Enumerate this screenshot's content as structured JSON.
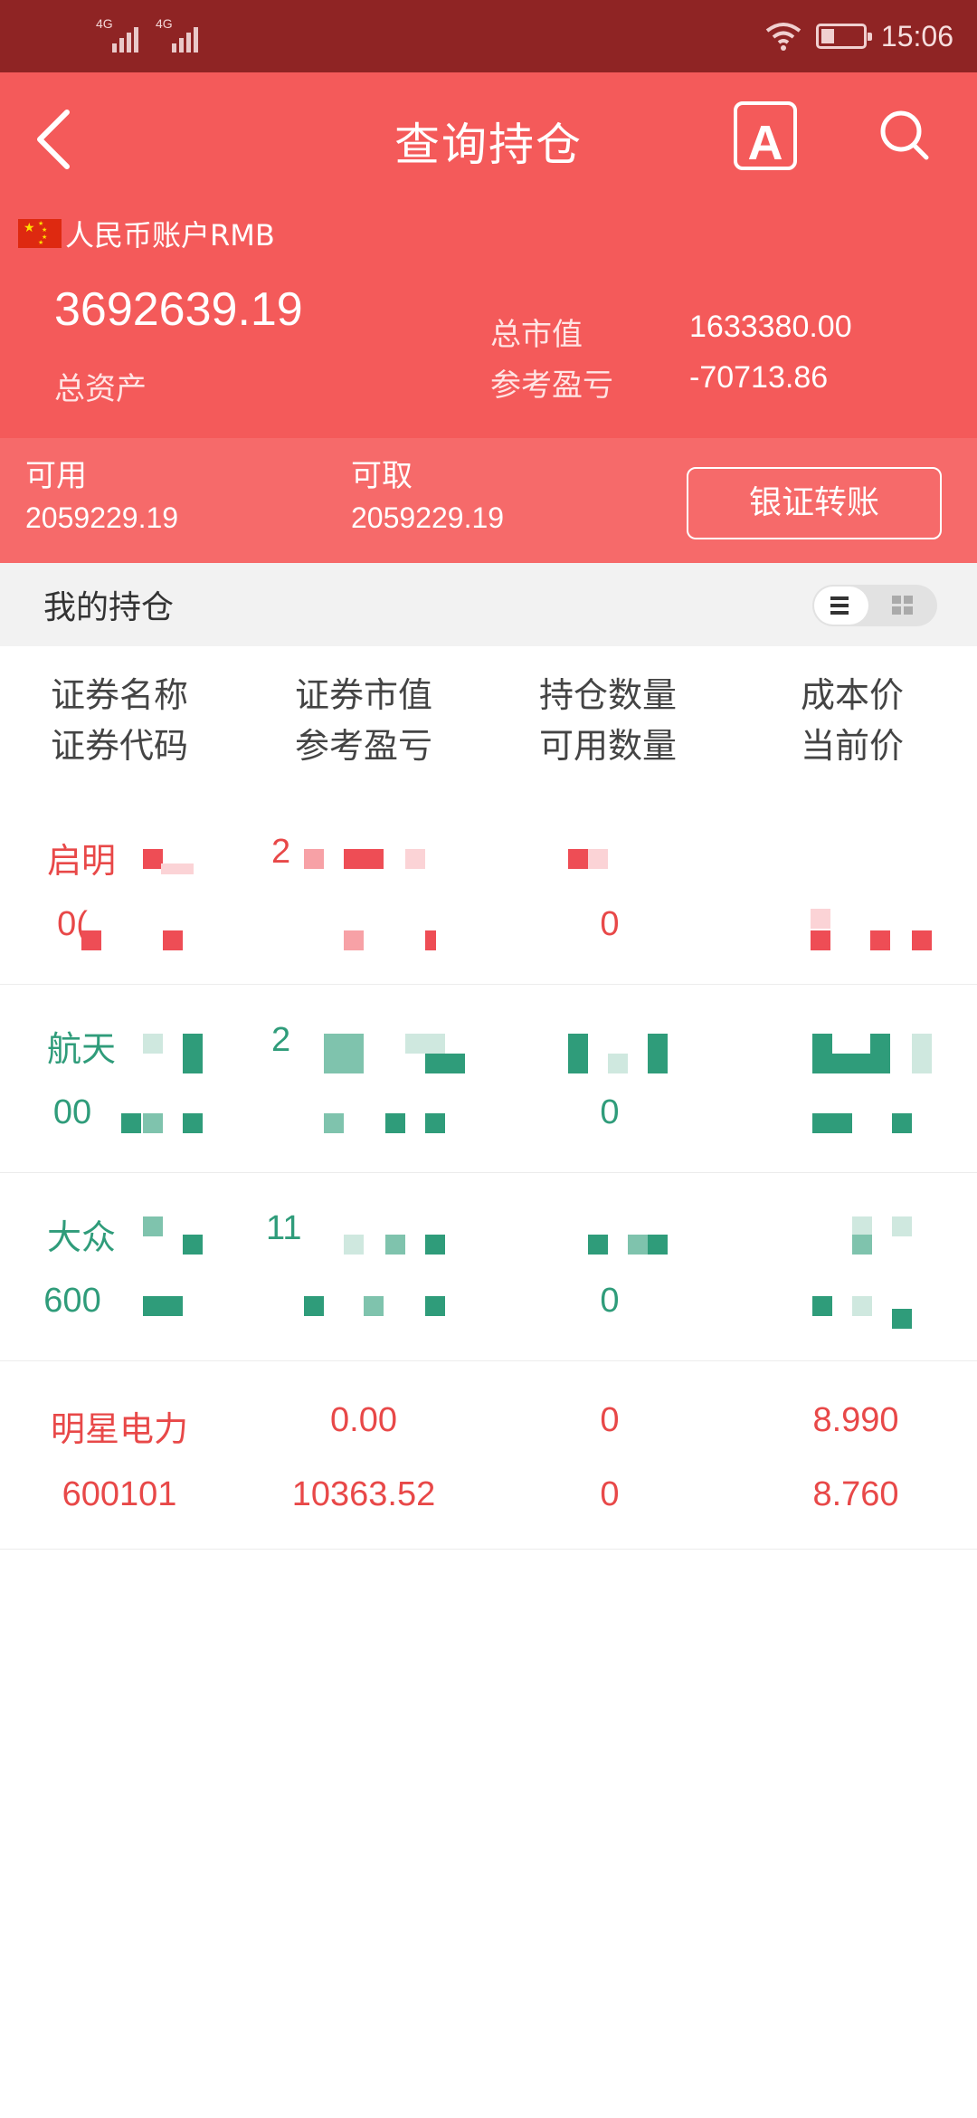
{
  "status_bar": {
    "time": "15:06",
    "network_1": "4G",
    "network_2": "4G"
  },
  "header": {
    "title": "查询持仓",
    "a_button": "A",
    "account_label": "人民币账户RMB",
    "total_assets_value": "3692639.19",
    "total_assets_label": "总资产",
    "market_value_label": "总市值",
    "market_value": "1633380.00",
    "pnl_label": "参考盈亏",
    "pnl_value": "-70713.86"
  },
  "balances": {
    "available_label": "可用",
    "available_value": "2059229.19",
    "withdrawable_label": "可取",
    "withdrawable_value": "2059229.19",
    "transfer_button": "银证转账"
  },
  "holdings": {
    "section_title": "我的持仓",
    "columns": [
      {
        "line1": "证券名称",
        "line2": "证券代码"
      },
      {
        "line1": "证券市值",
        "line2": "参考盈亏"
      },
      {
        "line1": "持仓数量",
        "line2": "可用数量"
      },
      {
        "line1": "成本价",
        "line2": "当前价"
      }
    ],
    "rows": [
      {
        "name": "启明",
        "code": "0(",
        "market_value": "2",
        "pnl": "",
        "qty": "",
        "avail": "0",
        "cost": "",
        "price": "",
        "color": "#e84848"
      },
      {
        "name": "航天",
        "code": "00",
        "market_value": "2",
        "pnl": "",
        "qty": "",
        "avail": "0",
        "cost": "",
        "price": "",
        "color": "#2f9c7a"
      },
      {
        "name": "大众",
        "code": "600",
        "market_value": "11",
        "pnl": "",
        "qty": "",
        "avail": "0",
        "cost": "",
        "price": "",
        "color": "#2f9c7a"
      },
      {
        "name": "明星电力",
        "code": "600101",
        "market_value": "0.00",
        "pnl": "10363.52",
        "qty": "0",
        "avail": "0",
        "cost": "8.990",
        "price": "8.760",
        "color": "#e84848"
      }
    ]
  },
  "colors": {
    "header_red": "#f45a5a",
    "status_bar": "#8f2424",
    "gain_red": "#e84848",
    "loss_green": "#2f9c7a"
  },
  "icons": [
    "back-icon",
    "font-a-icon",
    "search-icon",
    "cn-flag-icon",
    "list-view-icon",
    "grid-view-icon",
    "wifi-icon",
    "battery-icon",
    "signal-icon"
  ]
}
